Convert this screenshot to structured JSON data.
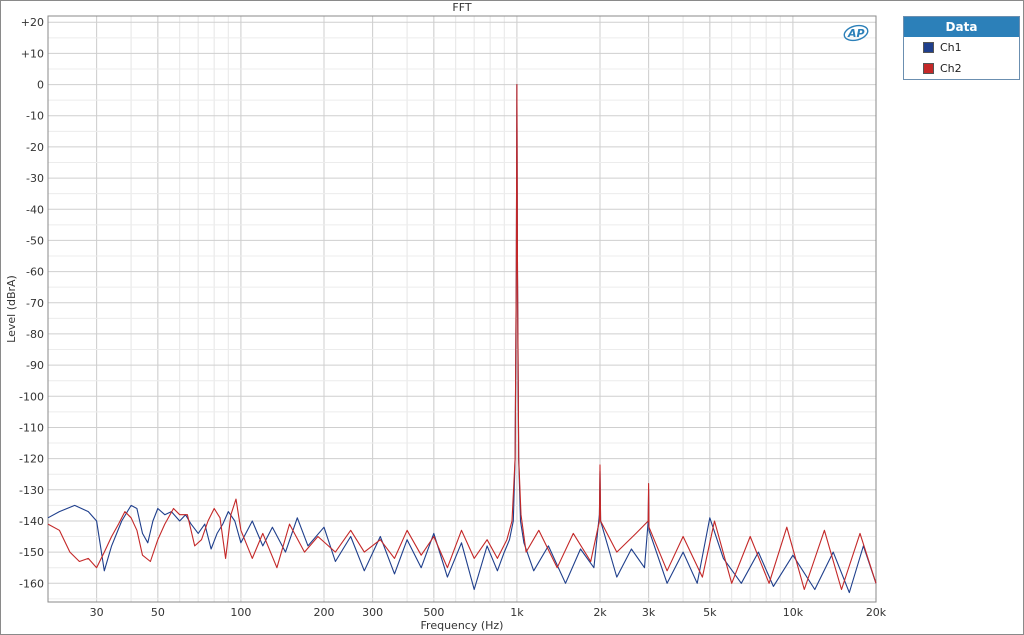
{
  "chart_data": {
    "type": "line",
    "title": "FFT",
    "xlabel": "Frequency (Hz)",
    "ylabel": "Level (dBrA)",
    "xscale": "log",
    "xlim": [
      20,
      20000
    ],
    "ylim": [
      -166,
      22
    ],
    "grid": true,
    "legend_placement": "top-right outside",
    "x_ticks": [
      {
        "v": 30,
        "label": "30"
      },
      {
        "v": 50,
        "label": "50"
      },
      {
        "v": 100,
        "label": "100"
      },
      {
        "v": 200,
        "label": "200"
      },
      {
        "v": 300,
        "label": "300"
      },
      {
        "v": 500,
        "label": "500"
      },
      {
        "v": 1000,
        "label": "1k"
      },
      {
        "v": 2000,
        "label": "2k"
      },
      {
        "v": 3000,
        "label": "3k"
      },
      {
        "v": 5000,
        "label": "5k"
      },
      {
        "v": 10000,
        "label": "10k"
      },
      {
        "v": 20000,
        "label": "20k"
      }
    ],
    "y_ticks": [
      {
        "v": 20,
        "label": "+20"
      },
      {
        "v": 10,
        "label": "+10"
      },
      {
        "v": 0,
        "label": "0"
      },
      {
        "v": -10,
        "label": "-10"
      },
      {
        "v": -20,
        "label": "-20"
      },
      {
        "v": -30,
        "label": "-30"
      },
      {
        "v": -40,
        "label": "-40"
      },
      {
        "v": -50,
        "label": "-50"
      },
      {
        "v": -60,
        "label": "-60"
      },
      {
        "v": -70,
        "label": "-70"
      },
      {
        "v": -80,
        "label": "-80"
      },
      {
        "v": -90,
        "label": "-90"
      },
      {
        "v": -100,
        "label": "-100"
      },
      {
        "v": -110,
        "label": "-110"
      },
      {
        "v": -120,
        "label": "-120"
      },
      {
        "v": -130,
        "label": "-130"
      },
      {
        "v": -140,
        "label": "-140"
      },
      {
        "v": -150,
        "label": "-150"
      },
      {
        "v": -160,
        "label": "-160"
      }
    ],
    "series": [
      {
        "name": "Ch1",
        "color": "#1f3f8c",
        "points": [
          [
            20,
            -139
          ],
          [
            22,
            -137
          ],
          [
            25,
            -135
          ],
          [
            28,
            -137
          ],
          [
            30,
            -140
          ],
          [
            32,
            -156
          ],
          [
            34,
            -148
          ],
          [
            37,
            -140
          ],
          [
            40,
            -135
          ],
          [
            42,
            -136
          ],
          [
            44,
            -144
          ],
          [
            46,
            -147
          ],
          [
            48,
            -140
          ],
          [
            50,
            -136
          ],
          [
            53,
            -138
          ],
          [
            56,
            -137
          ],
          [
            60,
            -140
          ],
          [
            63,
            -138
          ],
          [
            66,
            -141
          ],
          [
            70,
            -144
          ],
          [
            74,
            -141
          ],
          [
            78,
            -149
          ],
          [
            82,
            -144
          ],
          [
            86,
            -141
          ],
          [
            90,
            -137
          ],
          [
            95,
            -140
          ],
          [
            100,
            -147
          ],
          [
            110,
            -140
          ],
          [
            120,
            -148
          ],
          [
            130,
            -142
          ],
          [
            145,
            -150
          ],
          [
            160,
            -139
          ],
          [
            175,
            -148
          ],
          [
            200,
            -142
          ],
          [
            220,
            -153
          ],
          [
            250,
            -145
          ],
          [
            280,
            -156
          ],
          [
            320,
            -145
          ],
          [
            360,
            -157
          ],
          [
            400,
            -146
          ],
          [
            450,
            -155
          ],
          [
            500,
            -144
          ],
          [
            560,
            -158
          ],
          [
            630,
            -147
          ],
          [
            700,
            -162
          ],
          [
            780,
            -148
          ],
          [
            850,
            -156
          ],
          [
            900,
            -150
          ],
          [
            940,
            -146
          ],
          [
            970,
            -140
          ],
          [
            985,
            -120
          ],
          [
            995,
            -60
          ],
          [
            1000,
            0
          ],
          [
            1005,
            -60
          ],
          [
            1015,
            -120
          ],
          [
            1030,
            -140
          ],
          [
            1060,
            -147
          ],
          [
            1150,
            -156
          ],
          [
            1300,
            -148
          ],
          [
            1500,
            -160
          ],
          [
            1700,
            -149
          ],
          [
            1900,
            -155
          ],
          [
            1990,
            -138
          ],
          [
            2000,
            -124
          ],
          [
            2010,
            -140
          ],
          [
            2300,
            -158
          ],
          [
            2600,
            -149
          ],
          [
            2900,
            -155
          ],
          [
            2990,
            -140
          ],
          [
            3000,
            -130
          ],
          [
            3010,
            -143
          ],
          [
            3500,
            -160
          ],
          [
            4000,
            -150
          ],
          [
            4500,
            -160
          ],
          [
            5000,
            -139
          ],
          [
            5600,
            -152
          ],
          [
            6500,
            -160
          ],
          [
            7500,
            -150
          ],
          [
            8500,
            -161
          ],
          [
            10000,
            -151
          ],
          [
            12000,
            -162
          ],
          [
            14000,
            -150
          ],
          [
            16000,
            -163
          ],
          [
            18000,
            -148
          ],
          [
            20000,
            -160
          ]
        ]
      },
      {
        "name": "Ch2",
        "color": "#c42828",
        "points": [
          [
            20,
            -141
          ],
          [
            22,
            -143
          ],
          [
            24,
            -150
          ],
          [
            26,
            -153
          ],
          [
            28,
            -152
          ],
          [
            30,
            -155
          ],
          [
            32,
            -150
          ],
          [
            34,
            -145
          ],
          [
            36,
            -141
          ],
          [
            38,
            -137
          ],
          [
            40,
            -139
          ],
          [
            42,
            -143
          ],
          [
            44,
            -151
          ],
          [
            47,
            -153
          ],
          [
            50,
            -146
          ],
          [
            53,
            -141
          ],
          [
            57,
            -136
          ],
          [
            60,
            -138
          ],
          [
            64,
            -138
          ],
          [
            68,
            -148
          ],
          [
            72,
            -146
          ],
          [
            76,
            -140
          ],
          [
            80,
            -136
          ],
          [
            84,
            -139
          ],
          [
            88,
            -152
          ],
          [
            92,
            -138
          ],
          [
            96,
            -133
          ],
          [
            100,
            -143
          ],
          [
            110,
            -152
          ],
          [
            120,
            -144
          ],
          [
            135,
            -155
          ],
          [
            150,
            -141
          ],
          [
            170,
            -150
          ],
          [
            190,
            -145
          ],
          [
            220,
            -150
          ],
          [
            250,
            -143
          ],
          [
            280,
            -150
          ],
          [
            320,
            -146
          ],
          [
            360,
            -152
          ],
          [
            400,
            -143
          ],
          [
            450,
            -151
          ],
          [
            500,
            -145
          ],
          [
            560,
            -155
          ],
          [
            630,
            -143
          ],
          [
            700,
            -152
          ],
          [
            780,
            -146
          ],
          [
            850,
            -152
          ],
          [
            920,
            -146
          ],
          [
            960,
            -140
          ],
          [
            985,
            -120
          ],
          [
            995,
            -60
          ],
          [
            1000,
            0
          ],
          [
            1005,
            -60
          ],
          [
            1015,
            -120
          ],
          [
            1035,
            -138
          ],
          [
            1080,
            -150
          ],
          [
            1200,
            -143
          ],
          [
            1400,
            -155
          ],
          [
            1600,
            -144
          ],
          [
            1850,
            -153
          ],
          [
            1990,
            -140
          ],
          [
            2000,
            -122
          ],
          [
            2010,
            -140
          ],
          [
            2300,
            -150
          ],
          [
            2700,
            -144
          ],
          [
            2990,
            -140
          ],
          [
            3000,
            -128
          ],
          [
            3010,
            -142
          ],
          [
            3500,
            -156
          ],
          [
            4000,
            -145
          ],
          [
            4700,
            -158
          ],
          [
            5200,
            -140
          ],
          [
            6000,
            -160
          ],
          [
            7000,
            -145
          ],
          [
            8200,
            -160
          ],
          [
            9500,
            -142
          ],
          [
            11000,
            -162
          ],
          [
            13000,
            -143
          ],
          [
            15000,
            -162
          ],
          [
            17500,
            -144
          ],
          [
            20000,
            -160
          ]
        ]
      }
    ]
  },
  "legend": {
    "header": "Data",
    "items": [
      {
        "label": "Ch1",
        "color": "#1f3f8c"
      },
      {
        "label": "Ch2",
        "color": "#c42828"
      }
    ]
  }
}
